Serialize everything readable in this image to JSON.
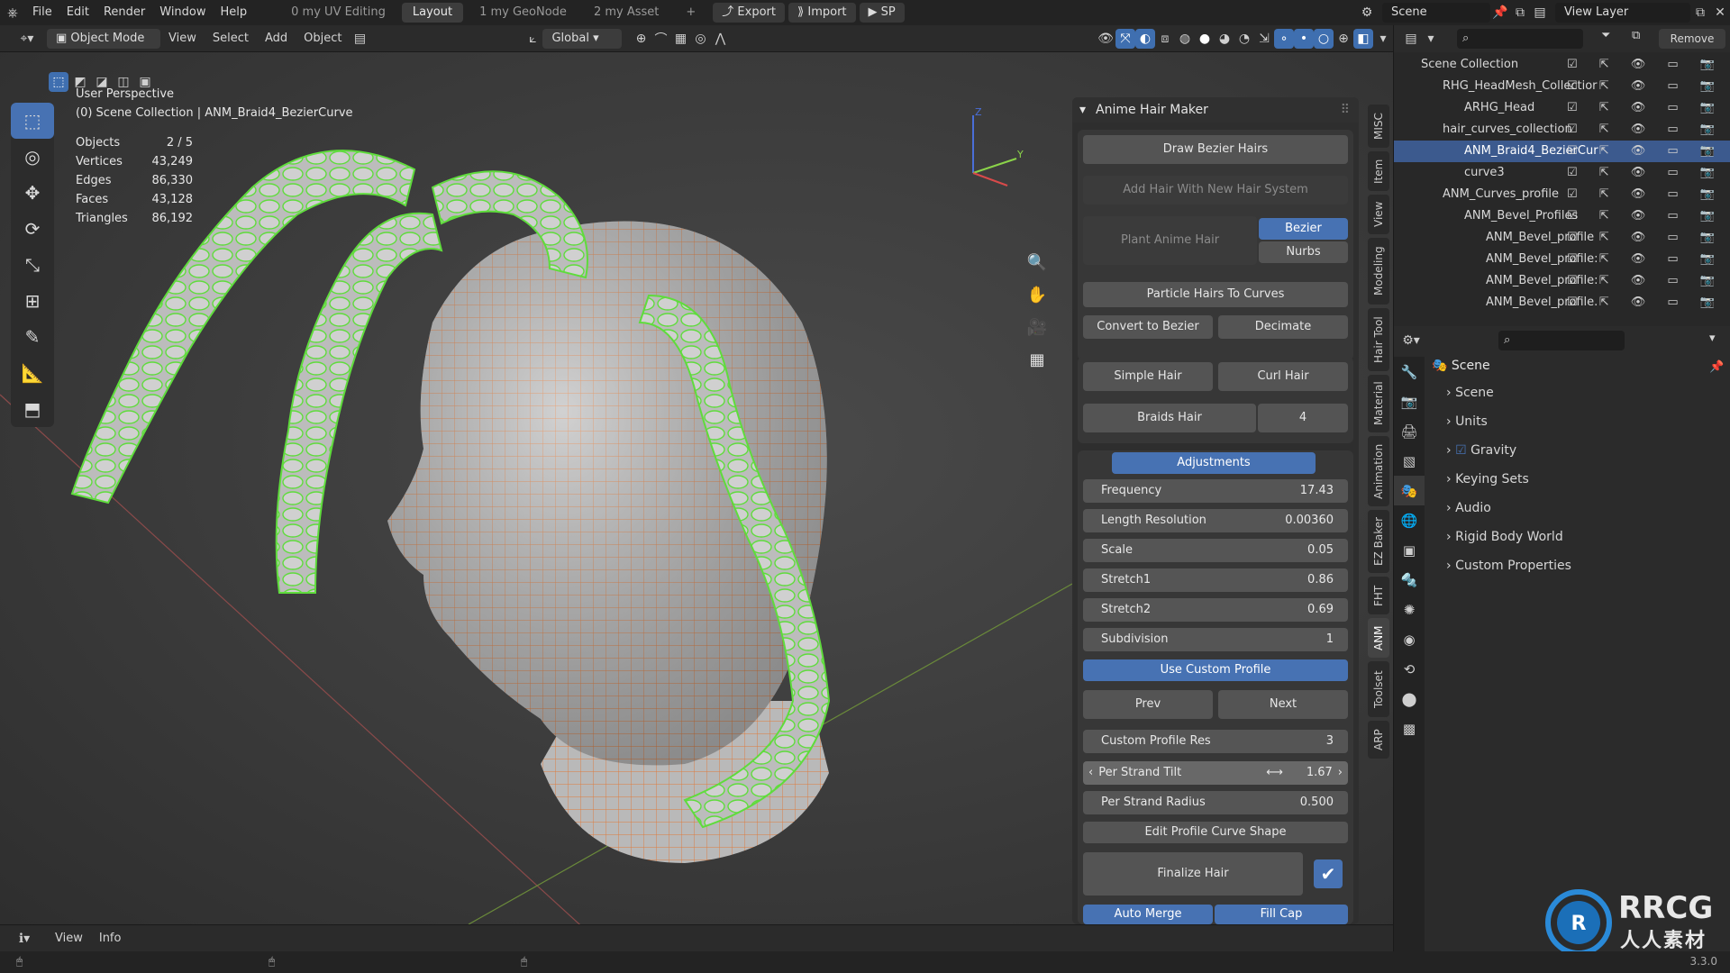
{
  "topbar": {
    "menus": [
      "File",
      "Edit",
      "Render",
      "Window",
      "Help"
    ],
    "workspaces": [
      "0 my UV Editing",
      "Layout",
      "1 my GeoNode",
      "2 my Asset"
    ],
    "active_workspace": "Layout",
    "export_label": "Export",
    "import_label": "Import",
    "sp_label": "SP",
    "scene_label": "Scene",
    "view_layer_label": "View Layer"
  },
  "header": {
    "mode": "Object Mode",
    "menus": [
      "View",
      "Select",
      "Add",
      "Object"
    ],
    "transform": "Global"
  },
  "viewport": {
    "perspective": "User Perspective",
    "collection": "(0) Scene Collection | ANM_Braid4_BezierCurve",
    "stats": [
      {
        "k": "Objects",
        "v": "2 / 5"
      },
      {
        "k": "Vertices",
        "v": "43,249"
      },
      {
        "k": "Edges",
        "v": "86,330"
      },
      {
        "k": "Faces",
        "v": "43,128"
      },
      {
        "k": "Triangles",
        "v": "86,192"
      }
    ],
    "axes": {
      "z": "Z",
      "y": "Y"
    }
  },
  "npanel": {
    "title": "Anime Hair Maker",
    "draw_bezier": "Draw Bezier Hairs",
    "add_hair": "Add Hair With New Hair System",
    "plant": "Plant Anime Hair",
    "bezier": "Bezier",
    "nurbs": "Nurbs",
    "particle": "Particle Hairs To Curves",
    "convert": "Convert to Bezier",
    "decimate": "Decimate",
    "simple": "Simple Hair",
    "curl": "Curl Hair",
    "braids": "Braids Hair",
    "braids_count": "4",
    "adjustments": "Adjustments",
    "fields": [
      {
        "k": "Frequency",
        "v": "17.43"
      },
      {
        "k": "Length Resolution",
        "v": "0.00360"
      },
      {
        "k": "Scale",
        "v": "0.05"
      },
      {
        "k": "Stretch1",
        "v": "0.86"
      },
      {
        "k": "Stretch2",
        "v": "0.69"
      },
      {
        "k": "Subdivision",
        "v": "1"
      }
    ],
    "use_custom_profile": "Use Custom Profile",
    "prev": "Prev",
    "next": "Next",
    "custom_profile_res": {
      "k": "Custom Profile Res",
      "v": "3"
    },
    "per_strand_tilt": {
      "k": "Per Strand Tilt",
      "v": "1.67"
    },
    "per_strand_radius": {
      "k": "Per Strand Radius",
      "v": "0.500"
    },
    "edit_profile": "Edit Profile Curve Shape",
    "finalize": "Finalize Hair",
    "auto_merge": "Auto Merge",
    "fill_cap": "Fill Cap"
  },
  "vtabs": [
    "MISC",
    "Item",
    "View",
    "Modeling",
    "Hair Tool",
    "Material",
    "Animation",
    "EZ Baker",
    "FHT",
    "ANM",
    "Toolset",
    "ARP"
  ],
  "vtab_active": "ANM",
  "outliner": {
    "remove_label": "Remove",
    "rows": [
      {
        "label": "Scene Collection",
        "indent": 0,
        "sel": false
      },
      {
        "label": "RHG_HeadMesh_Collectior",
        "indent": 1,
        "sel": false
      },
      {
        "label": "ARHG_Head",
        "indent": 2,
        "sel": false
      },
      {
        "label": "hair_curves_collection",
        "indent": 1,
        "sel": false
      },
      {
        "label": "ANM_Braid4_BezierCur",
        "indent": 2,
        "sel": true
      },
      {
        "label": "curve3",
        "indent": 2,
        "sel": false
      },
      {
        "label": "ANM_Curves_profile",
        "indent": 1,
        "sel": false
      },
      {
        "label": "ANM_Bevel_Profiles",
        "indent": 2,
        "sel": false
      },
      {
        "label": "ANM_Bevel_profile",
        "indent": 3,
        "sel": false
      },
      {
        "label": "ANM_Bevel_profile:",
        "indent": 3,
        "sel": false
      },
      {
        "label": "ANM_Bevel_profile:",
        "indent": 3,
        "sel": false
      },
      {
        "label": "ANM_Bevel_profile.",
        "indent": 3,
        "sel": false
      }
    ]
  },
  "properties": {
    "title": "Scene",
    "items": [
      "Scene",
      "Units",
      "Gravity",
      "Keying Sets",
      "Audio",
      "Rigid Body World",
      "Custom Properties"
    ]
  },
  "timeline": {
    "menus": [
      "View",
      "Info"
    ]
  },
  "status": {
    "version": "3.3.0"
  },
  "watermark": {
    "brand": "RRCG",
    "sub": "人人素材"
  },
  "colors": {
    "accent": "#4772b3",
    "wire_orange": "#e07a3a",
    "hair_green": "#5fdc3c"
  }
}
